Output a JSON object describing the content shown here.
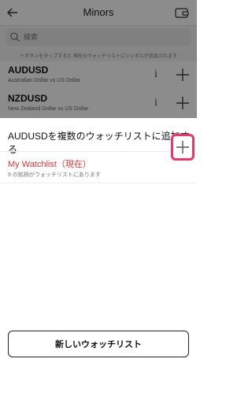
{
  "header": {
    "title": "Minors",
    "back_icon": "arrow-left-icon",
    "wallet_icon": "wallet-icon"
  },
  "search": {
    "placeholder": "検索"
  },
  "hint": "＋ボタンをタップすると 現在のウォッチリストにシンボルが追加されます",
  "rows": [
    {
      "symbol": "AUDUSD",
      "description": "Australian Dollar vs US Dollar",
      "info": "i"
    },
    {
      "symbol": "NZDUSD",
      "description": "New Zealand Dollar vs US Dollar",
      "info": "i"
    }
  ],
  "sheet": {
    "title": "AUDUSDを複数のウォッチリストに追加する",
    "watchlist": {
      "name": "My Watchlist（現在）",
      "count": "9 の銘柄がウォッチリストにあります"
    },
    "new_button": "新しいウォッチリスト"
  },
  "colors": {
    "accent_red": "#d9383c",
    "highlight_pink": "#e7396b"
  }
}
